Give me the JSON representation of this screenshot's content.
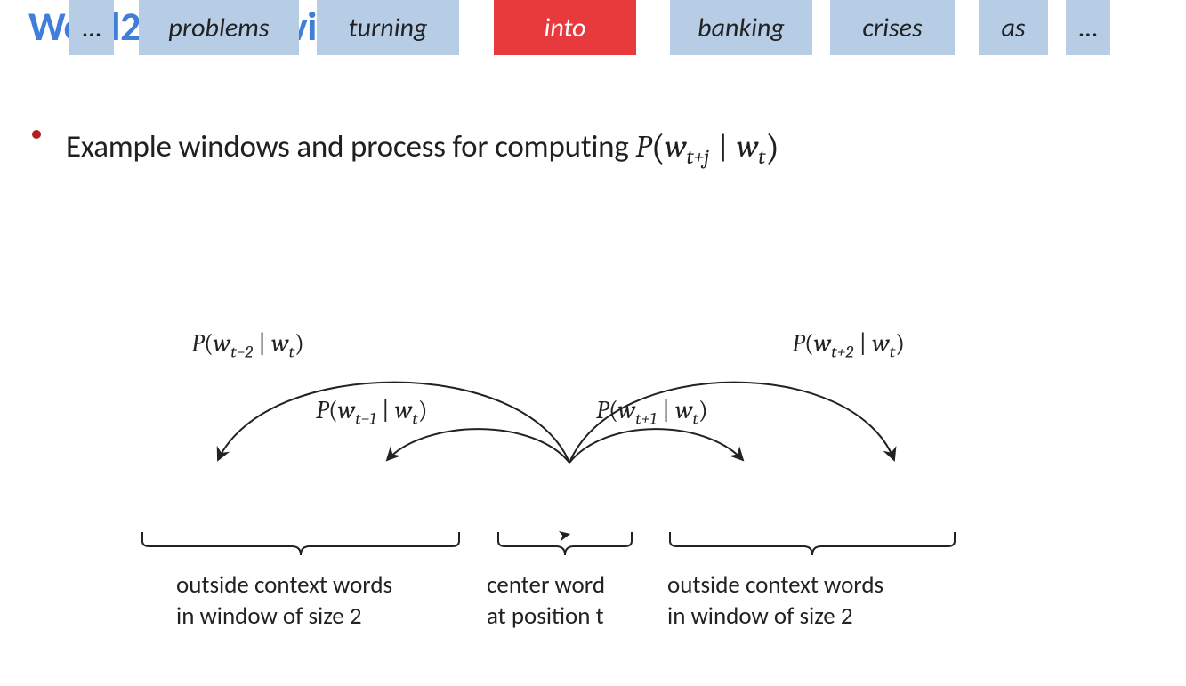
{
  "title": "Word2Vec Overview",
  "bullet_text": "Example windows and process for computing ",
  "formula": {
    "head": "P",
    "lpar": "(",
    "w": "w",
    "tplusj": "t+j",
    "bar": " | ",
    "w2": "w",
    "t": "t",
    "rpar": ")"
  },
  "arc_labels": {
    "m2": {
      "head": "P",
      "lpar": "(",
      "w": "w",
      "idx": "t−2",
      "bar": " | ",
      "w2": "w",
      "t": "t",
      "rpar": ")"
    },
    "m1": {
      "head": "P",
      "lpar": "(",
      "w": "w",
      "idx": "t−1",
      "bar": " | ",
      "w2": "w",
      "t": "t",
      "rpar": ")"
    },
    "p1": {
      "head": "P",
      "lpar": "(",
      "w": "w",
      "idx": "t+1",
      "bar": " | ",
      "w2": "w",
      "t": "t",
      "rpar": ")"
    },
    "p2": {
      "head": "P",
      "lpar": "(",
      "w": "w",
      "idx": "t+2",
      "bar": " | ",
      "w2": "w",
      "t": "t",
      "rpar": ")"
    }
  },
  "words": {
    "dots_l": "…",
    "w_problems": "problems",
    "w_turning": "turning",
    "w_into": "into",
    "w_banking": "banking",
    "w_crises": "crises",
    "w_as": "as",
    "dots_r": "…"
  },
  "captions": {
    "left1": "outside context words",
    "left2": "in window of size 2",
    "center1": "center word",
    "center2": "at position t",
    "right1": "outside context words",
    "right2": "in window of size 2"
  }
}
